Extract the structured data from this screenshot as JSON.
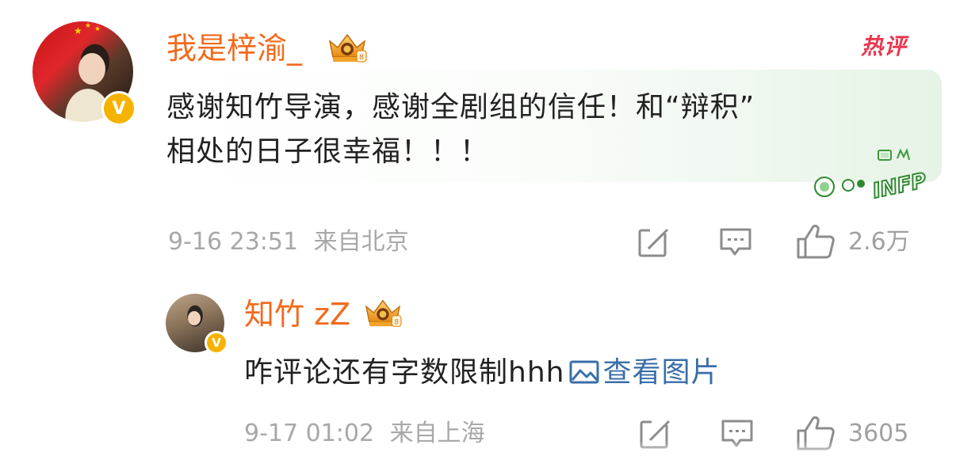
{
  "comments": [
    {
      "username": "我是梓渝_",
      "verified_badge": "v-badge",
      "level_icon": "crown-icon",
      "hot_label": "热评",
      "text_line1": "感谢知竹导演，感谢全剧组的信任！和“辩积”",
      "text_line2": "相处的日子很幸福！！！",
      "time": "9-16 23:51",
      "location": "来自北京",
      "like_count": "2.6万",
      "actions": [
        "share-icon",
        "comment-icon",
        "like-icon"
      ],
      "decoration": "INFP"
    },
    {
      "username": "知竹 zZ",
      "verified_badge": "v-badge",
      "level_icon": "crown-icon",
      "text": "咋评论还有字数限制hhh",
      "link_label": "查看图片",
      "time": "9-17 01:02",
      "location": "来自上海",
      "like_count": "3605",
      "actions": [
        "share-icon",
        "comment-icon",
        "like-icon"
      ]
    }
  ],
  "colors": {
    "username": "#f26b1d",
    "hot": "#e8384f",
    "meta": "#a8a8a8",
    "link": "#3a6ea8",
    "text": "#222222",
    "vip_gold": "#f5b300"
  }
}
